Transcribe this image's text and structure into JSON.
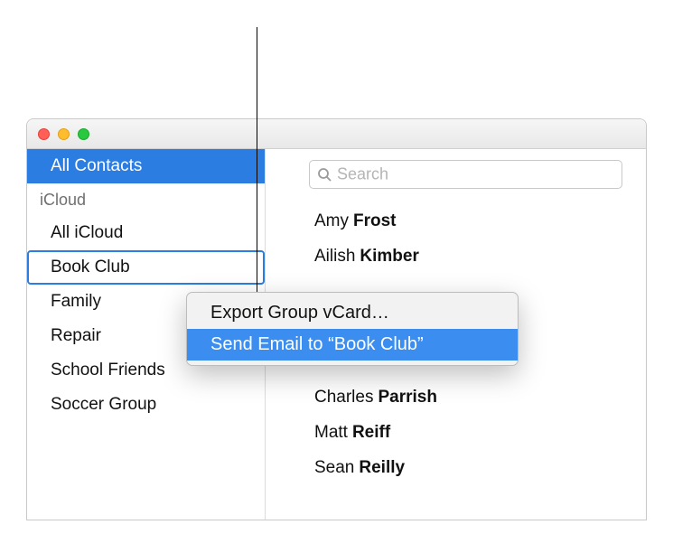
{
  "sidebar": {
    "all_contacts": "All Contacts",
    "section_label": "iCloud",
    "items": [
      {
        "label": "All iCloud"
      },
      {
        "label": "Book Club"
      },
      {
        "label": "Family"
      },
      {
        "label": "Repair"
      },
      {
        "label": "School Friends"
      },
      {
        "label": "Soccer Group"
      }
    ]
  },
  "search": {
    "placeholder": "Search"
  },
  "contacts": [
    {
      "first": "Amy",
      "last": "Frost"
    },
    {
      "first": "Ailish",
      "last": "Kimber"
    },
    {
      "first": "",
      "last": ""
    },
    {
      "first": "",
      "last": ""
    },
    {
      "first": "",
      "last": ""
    },
    {
      "first": "Charles",
      "last": "Parrish"
    },
    {
      "first": "Matt",
      "last": "Reiff"
    },
    {
      "first": "Sean",
      "last": "Reilly"
    }
  ],
  "context_menu": {
    "items": [
      {
        "label": "Export Group vCard…"
      },
      {
        "label": "Send Email to “Book Club”"
      }
    ]
  }
}
